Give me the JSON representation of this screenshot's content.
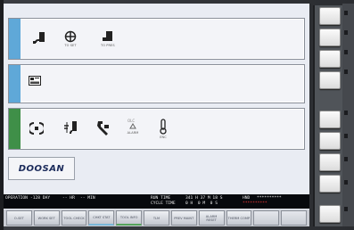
{
  "panels": [
    {
      "id": "top",
      "strip_color": "#5fa8d8",
      "icons": [
        {
          "name": "tool-offset-icon",
          "caption": ""
        },
        {
          "name": "offset-setting-icon",
          "caption": "TO SET"
        },
        {
          "name": "tool-preset-icon",
          "caption": "TO PRES"
        }
      ]
    },
    {
      "id": "middle",
      "strip_color": "#5fa8d8",
      "icons": [
        {
          "name": "program-display-icon",
          "caption": ""
        }
      ]
    },
    {
      "id": "bottom",
      "strip_color": "#3f8f48",
      "icons": [
        {
          "name": "spindle-icon",
          "caption": ""
        },
        {
          "name": "coolant-icon",
          "caption": ""
        },
        {
          "name": "maintenance-wrench-icon",
          "caption": ""
        },
        {
          "name": "alarm-icon",
          "caption": "ALARM"
        },
        {
          "name": "temperature-icon",
          "caption": "ENC"
        }
      ]
    }
  ],
  "logo": {
    "text": "DOOSAN"
  },
  "status": {
    "operation_label": "OPERATION",
    "operation_value": "-128 DAY",
    "hr": "-- HR",
    "min": "-- MIN",
    "run_time_label": "RUN TIME",
    "run_time_value": "341 H 37 M 18 S",
    "cycle_time_label": "CYCLE TIME",
    "cycle_time_value": "0 H  0 M  0 S",
    "mode": "HND",
    "run_dashes": "**********",
    "cycle_dashes": "**********"
  },
  "softkeys": [
    {
      "label": "O-SET",
      "style": ""
    },
    {
      "label": "WORK SET",
      "style": ""
    },
    {
      "label": "TOOL CHECK",
      "style": ""
    },
    {
      "label": "CHKT STAT",
      "style": "accent"
    },
    {
      "label": "TOOL INFO",
      "style": "accent2"
    },
    {
      "label": "TLM",
      "style": ""
    },
    {
      "label": "PREV MAINT",
      "style": ""
    },
    {
      "label": "ALARM RESET",
      "style": ""
    },
    {
      "label": "THERM COMP",
      "style": ""
    },
    {
      "label": "",
      "style": "blank"
    },
    {
      "label": "",
      "style": "blank"
    }
  ],
  "colors": {
    "status_background": "#07090d",
    "accent_blue": "#5fa8d8",
    "accent_green": "#3f8f48"
  }
}
